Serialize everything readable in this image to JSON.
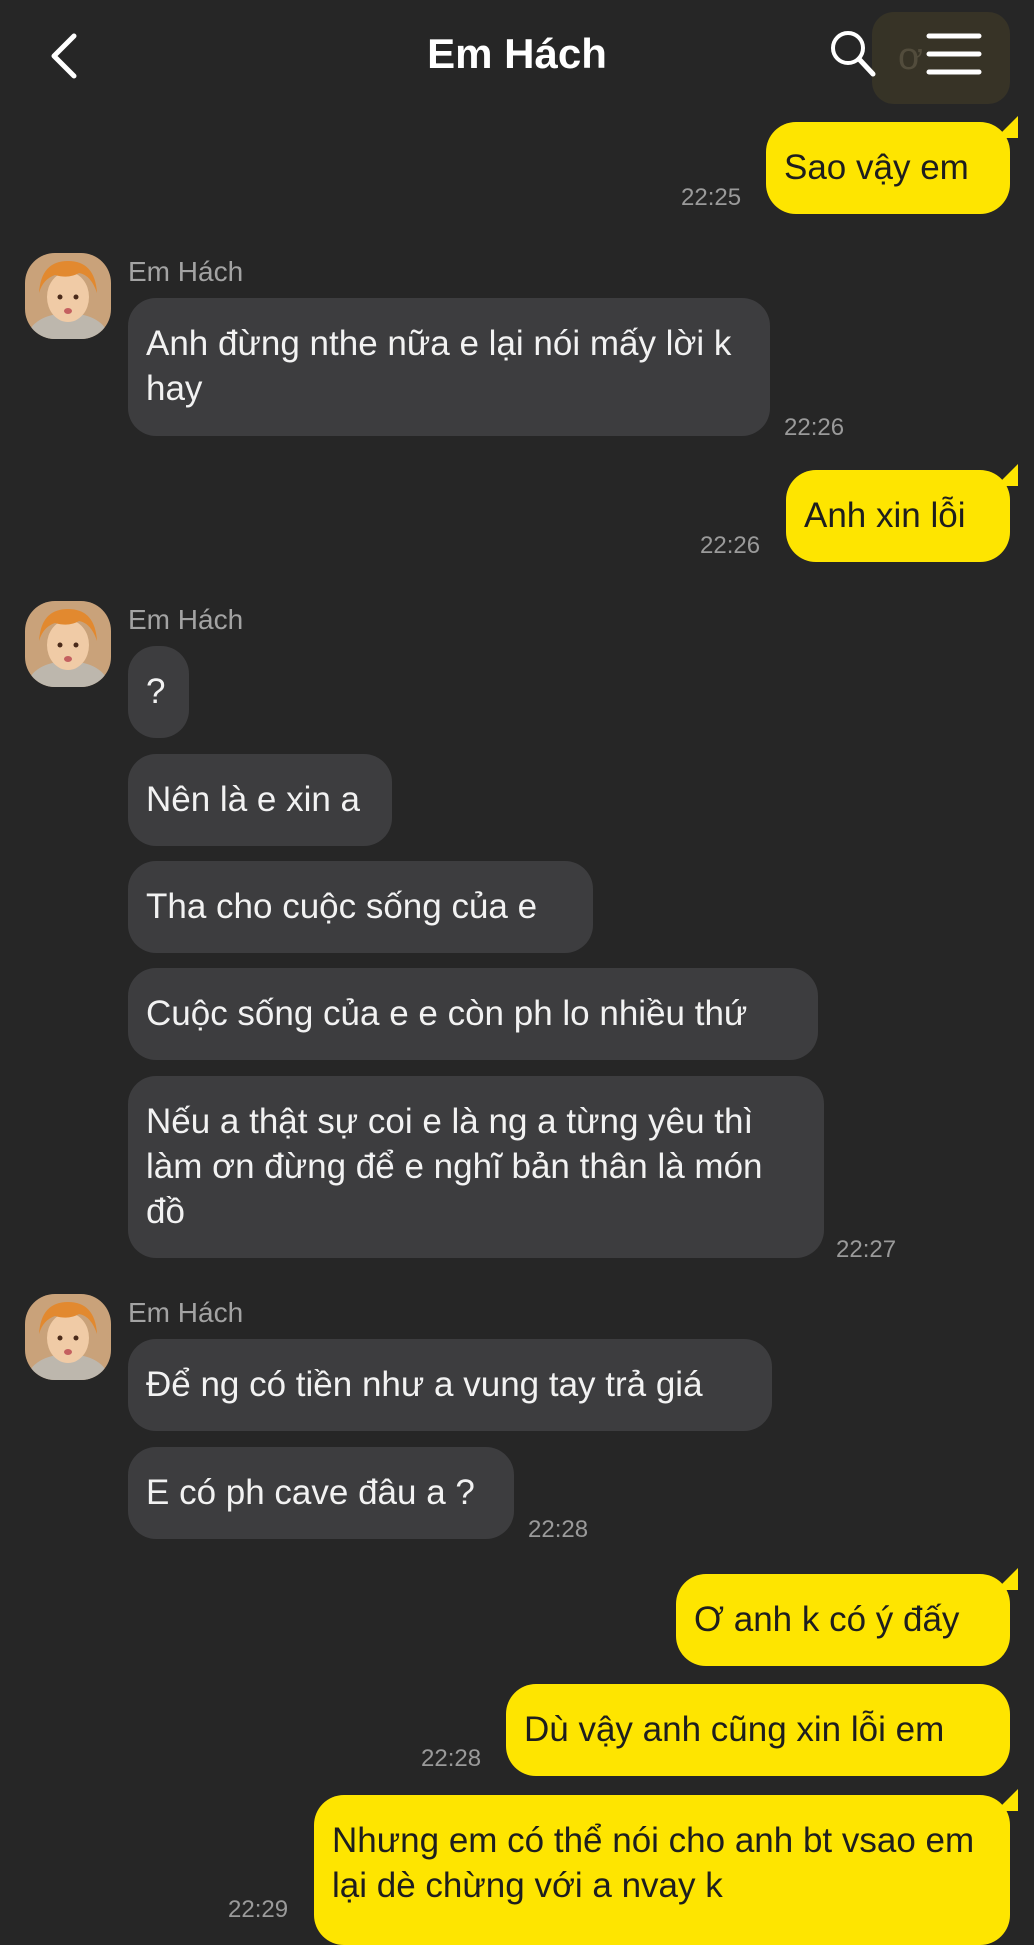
{
  "header": {
    "title": "Em Hách",
    "ghost_text": "ơ",
    "back_icon": "chevron-left-icon",
    "search_icon": "search-icon",
    "menu_icon": "menu-icon"
  },
  "colors": {
    "background": "#262626",
    "incoming_bubble": "#3d3d3f",
    "outgoing_bubble": "#fee500"
  },
  "messages": [
    {
      "direction": "out",
      "text": "Sao vậy em",
      "time": "22:25"
    },
    {
      "direction": "in",
      "sender": "Em Hách",
      "text": "Anh đừng nthe nữa e lại nói mấy lời k hay",
      "time": "22:26"
    },
    {
      "direction": "out",
      "text": "Anh xin lỗi",
      "time": "22:26"
    },
    {
      "direction": "in",
      "sender": "Em Hách",
      "text": "?"
    },
    {
      "direction": "in",
      "text": "Nên là e xin a"
    },
    {
      "direction": "in",
      "text": "Tha cho cuộc sống của e"
    },
    {
      "direction": "in",
      "text": "Cuộc sống của e e còn ph lo nhiều thứ"
    },
    {
      "direction": "in",
      "text": "Nếu a thật sự coi e là ng a từng yêu thì làm ơn đừng để e nghĩ bản thân là món đồ",
      "time": "22:27"
    },
    {
      "direction": "in",
      "sender": "Em Hách",
      "text": "Để ng có tiền như a vung tay trả giá"
    },
    {
      "direction": "in",
      "text": "E có ph cave đâu a ?",
      "time": "22:28"
    },
    {
      "direction": "out",
      "text": "Ơ anh k có ý đấy"
    },
    {
      "direction": "out",
      "text": "Dù vậy anh cũng xin lỗi em",
      "time": "22:28"
    },
    {
      "direction": "out",
      "text": "Nhưng em có thể nói cho anh bt vsao em lại dè chừng với a nvay k",
      "time": "22:29"
    }
  ]
}
